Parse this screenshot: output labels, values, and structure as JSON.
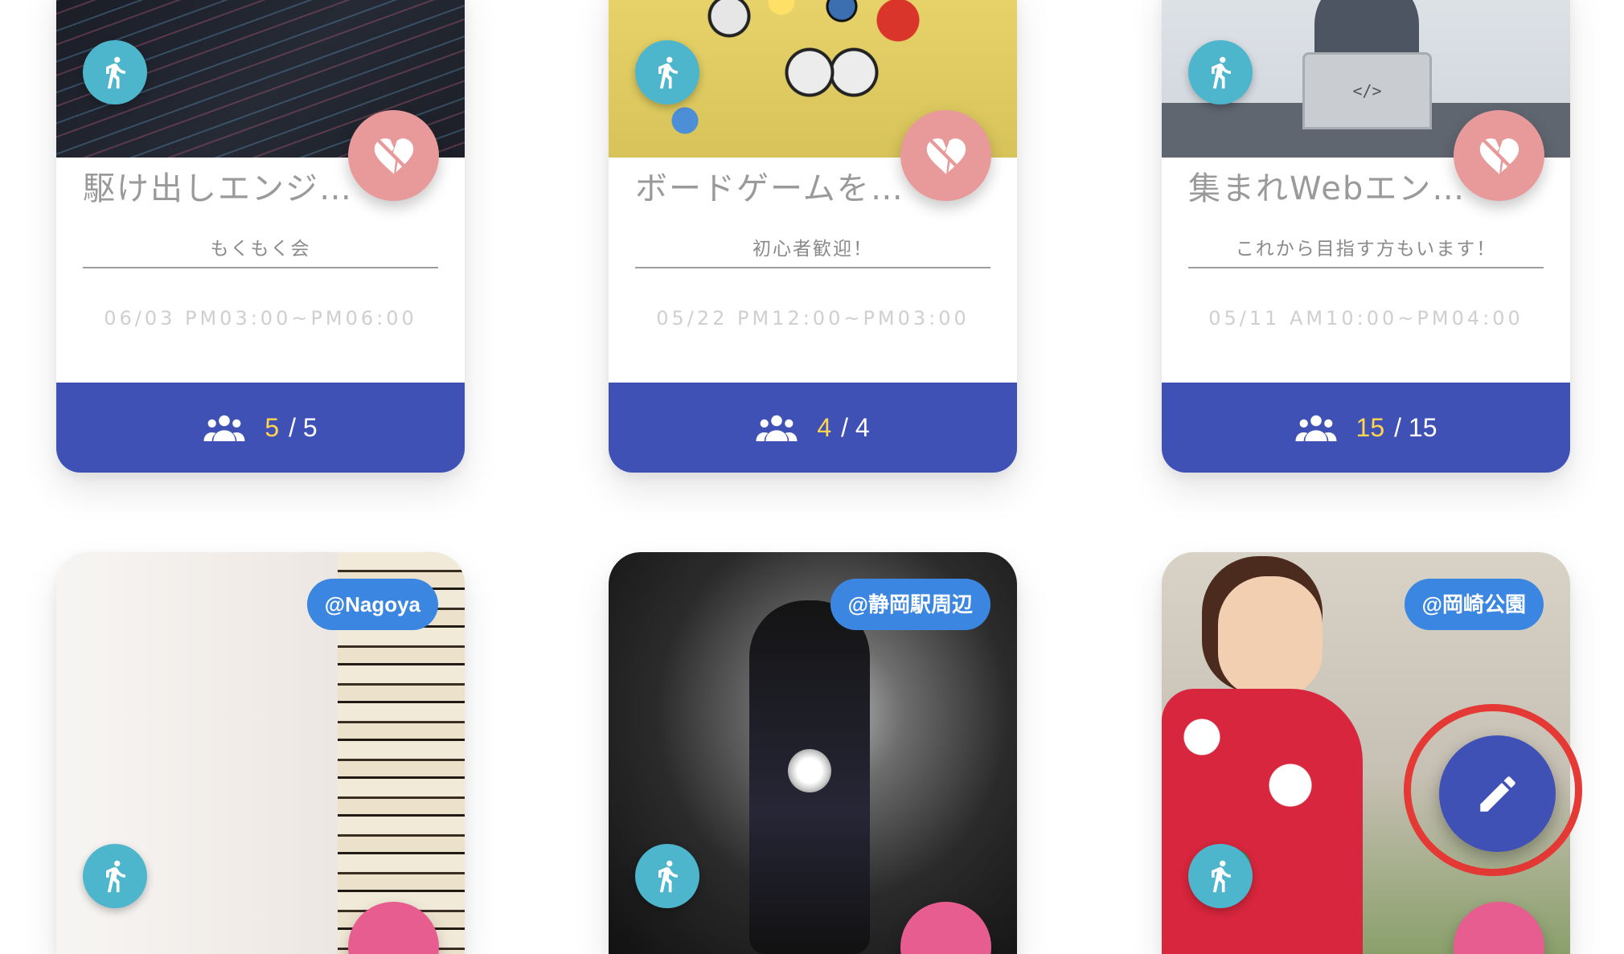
{
  "events": [
    {
      "title": "駆け出しエンジニア…",
      "subtitle": "もくもく会",
      "datetime": "06/03 PM03:00~PM06:00",
      "participants_current": "5",
      "participants_separator": "/ 5"
    },
    {
      "title": "ボードゲームをしま…",
      "subtitle": "初心者歓迎！",
      "datetime": "05/22 PM12:00~PM03:00",
      "participants_current": "4",
      "participants_separator": "/ 4"
    },
    {
      "title": "集まれWebエンジニア",
      "subtitle": "これから目指す方もいます！",
      "datetime": "05/11 AM10:00~PM04:00",
      "participants_current": "15",
      "participants_separator": "/ 15"
    }
  ],
  "lower_cards": [
    {
      "location": "@Nagoya"
    },
    {
      "location": "@静岡駅周辺"
    },
    {
      "location": "@岡崎公園"
    }
  ],
  "laptop_code_glyph": "</>",
  "icons": {
    "walk": "walk-icon",
    "heart_broken": "heart-broken-icon",
    "group": "group-icon",
    "edit": "pencil-icon"
  },
  "colors": {
    "primary": "#3f51b5",
    "accent_yellow": "#ffd54f",
    "walk_badge": "#4db6cc",
    "heart_fab": "#e89a9a",
    "location_tag": "#3b86e0",
    "highlight": "#e53935"
  }
}
